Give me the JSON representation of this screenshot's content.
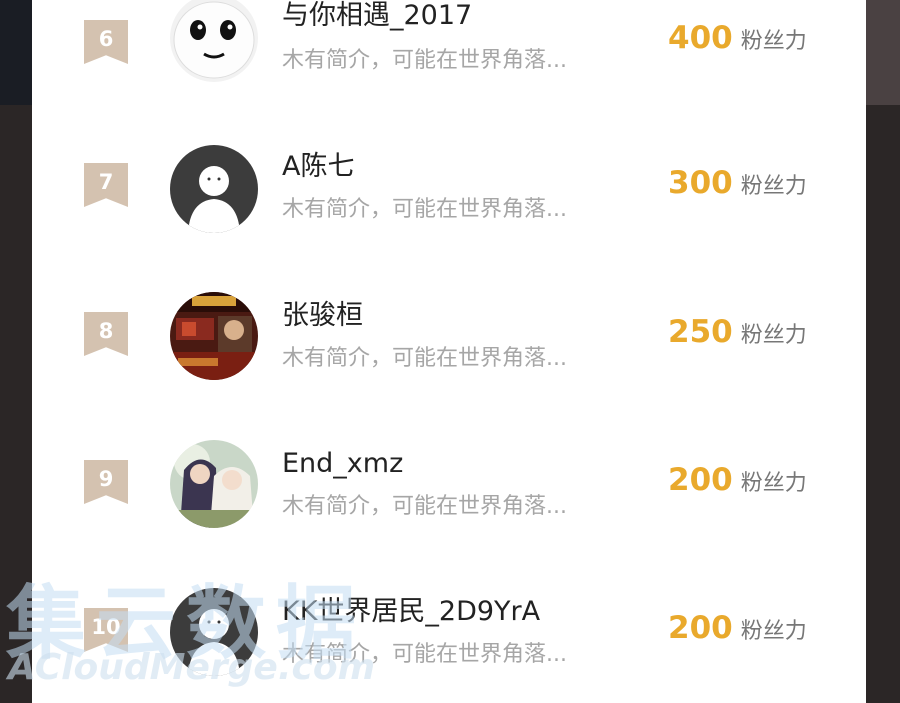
{
  "score_unit": "粉丝力",
  "rows": [
    {
      "rank": "6",
      "name": "与你相遇_2017",
      "bio": "木有简介，可能在世界角落...",
      "score": "400",
      "avatar_icon": "cartoon-face-icon"
    },
    {
      "rank": "7",
      "name": "A陈七",
      "bio": "木有简介，可能在世界角落...",
      "score": "300",
      "avatar_icon": "default-person-icon"
    },
    {
      "rank": "8",
      "name": "张骏桓",
      "bio": "木有简介，可能在世界角落...",
      "score": "250",
      "avatar_icon": "game-poster-avatar"
    },
    {
      "rank": "9",
      "name": "End_xmz",
      "bio": "木有简介，可能在世界角落...",
      "score": "200",
      "avatar_icon": "anime-couple-avatar"
    },
    {
      "rank": "10",
      "name": "KK世界居民_2D9YrA",
      "bio": "木有简介，可能在世界角落...",
      "score": "200",
      "avatar_icon": "default-person-icon"
    }
  ],
  "watermark": {
    "chinese": "集云数据",
    "english": "ACloudMerge.com"
  },
  "colors": {
    "rank_badge": "#d4c2b0",
    "score": "#e9a92c",
    "bio": "#a6a6a6"
  }
}
